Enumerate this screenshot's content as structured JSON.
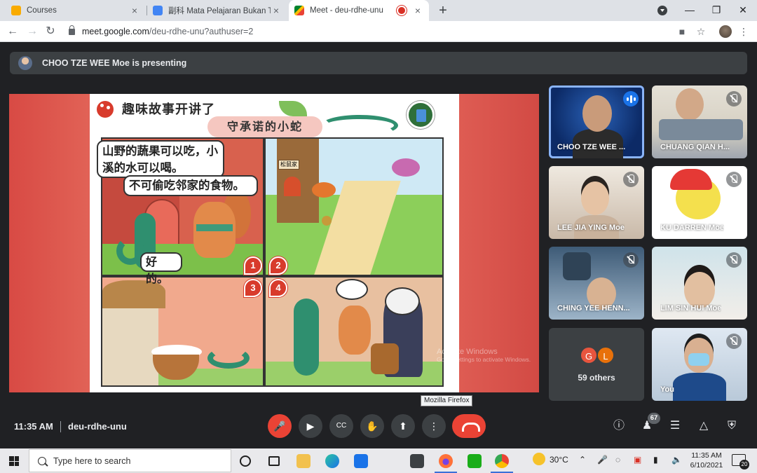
{
  "browser": {
    "tabs": [
      {
        "title": "Courses",
        "close": "×"
      },
      {
        "title": "副科 Mata Pelajaran Bukan Teras",
        "close": "×"
      },
      {
        "title": "Meet - deu-rdhe-unu",
        "close": "×"
      }
    ],
    "new_tab": "+",
    "url_host": "meet.google.com",
    "url_path": "/deu-rdhe-unu?authuser=2"
  },
  "meet": {
    "presenting_banner": "CHOO TZE WEE Moe is presenting",
    "comic": {
      "title": "趣味故事开讲了",
      "subtitle": "守承诺的小蛇",
      "bubble1": "山野的蔬果可以吃，小溪的水可以喝。",
      "bubble2": "不可偷吃邻家的食物。",
      "bubble3": "好的。",
      "sign": "松鼠家",
      "numbers": [
        "1",
        "2",
        "3",
        "4"
      ]
    },
    "watermark_title": "Activate Windows",
    "watermark_sub": "Go to Settings to activate Windows.",
    "participants": [
      {
        "name": "CHOO TZE WEE ..."
      },
      {
        "name": "CHUANG QIAN H..."
      },
      {
        "name": "LEE JIA YING Moe"
      },
      {
        "name": "KU DARREN Moe"
      },
      {
        "name": "CHING YEE HENN..."
      },
      {
        "name": "LIM SIN HUI Moe"
      },
      {
        "name": "You"
      }
    ],
    "others": {
      "avatars": [
        "G",
        "L"
      ],
      "label": "59 others",
      "colors": [
        "#e8553e",
        "#e8710a"
      ]
    },
    "time": "11:35 AM",
    "meeting_code": "deu-rdhe-unu",
    "people_count": "67",
    "tooltip": "Mozilla Firefox"
  },
  "taskbar": {
    "search_placeholder": "Type here to search",
    "temperature": "30°C",
    "clock_time": "11:35 AM",
    "clock_date": "6/10/2021",
    "notification_count": "20"
  },
  "colors": {
    "meet_bg": "#202124",
    "end_call": "#ea4335",
    "mic_off": "#ea4335",
    "speaking_outline": "#8ab4f8"
  }
}
